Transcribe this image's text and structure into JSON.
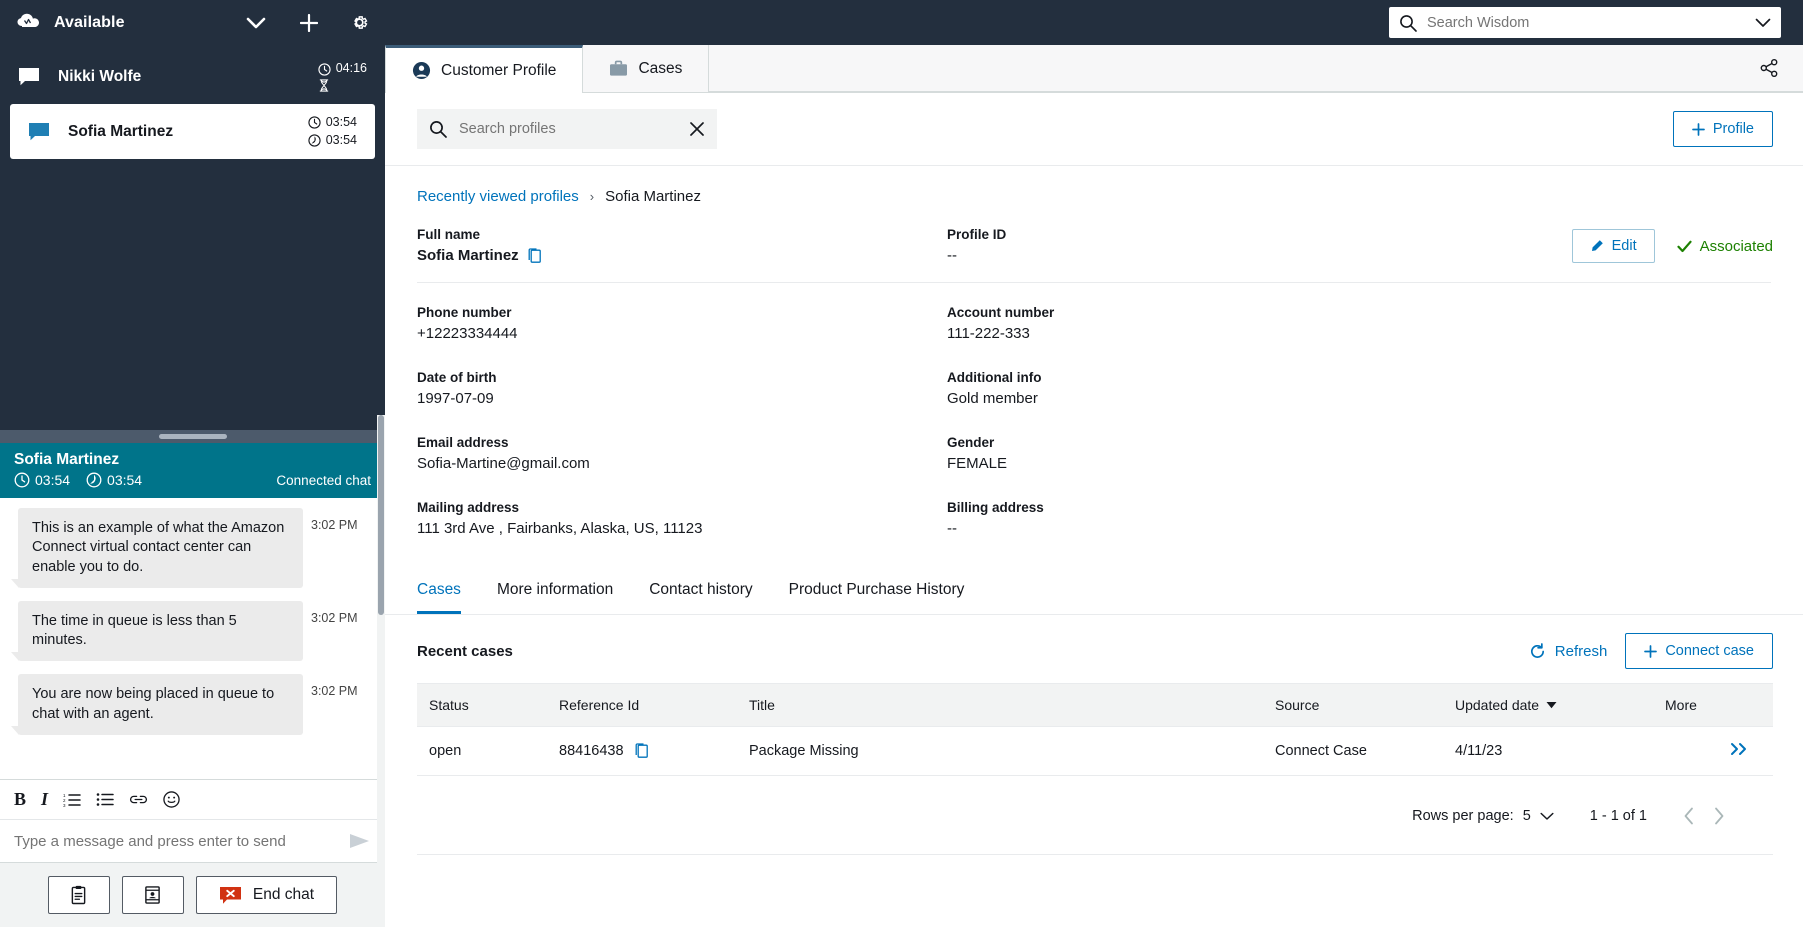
{
  "ccp": {
    "agent_status": "Available",
    "icons": {
      "logo": "amazon-connect-cloud-logo",
      "chevron": "chevron-down-icon",
      "plus": "plus-icon",
      "gear": "gear-icon"
    },
    "contacts": [
      {
        "name": "Nikki Wolfe",
        "timer_primary": "04:16",
        "timer_secondary": "",
        "active": false,
        "state_icon": "hourglass-icon"
      },
      {
        "name": "Sofia Martinez",
        "timer_primary": "03:54",
        "timer_secondary": "03:54",
        "active": true,
        "state_icon": "moon-icon"
      }
    ],
    "conversation": {
      "name": "Sofia Martinez",
      "timer_clock": "03:54",
      "timer_connected": "03:54",
      "state": "Connected chat"
    },
    "messages": [
      {
        "text": "This is an example of what the Amazon Connect virtual contact center can enable you to do.",
        "time": "3:02 PM"
      },
      {
        "text": "The time in queue is less than 5 minutes.",
        "time": "3:02 PM"
      },
      {
        "text": "You are now being placed in queue to chat with an agent.",
        "time": "3:02 PM"
      }
    ],
    "format_tools": [
      "bold-icon",
      "italic-icon",
      "numbered-list-icon",
      "bullet-list-icon",
      "link-icon",
      "emoji-icon"
    ],
    "format_labels": {
      "bold": "B",
      "italic": "I"
    },
    "composer_placeholder": "Type a message and press enter to send",
    "actions": {
      "quick_responses_icon": "clipboard-icon",
      "contact_attributes_icon": "contact-card-icon",
      "end_chat_label": "End chat",
      "end_chat_icon": "end-chat-icon"
    }
  },
  "topbar": {
    "search_placeholder": "Search Wisdom",
    "search_icon": "search-icon",
    "chevron_icon": "chevron-down-icon"
  },
  "tabs": [
    {
      "label": "Customer Profile",
      "icon": "user-circle-icon",
      "active": true
    },
    {
      "label": "Cases",
      "icon": "briefcase-icon",
      "active": false
    }
  ],
  "share_icon": "share-icon",
  "profile_search": {
    "placeholder": "Search profiles",
    "value": "",
    "search_icon": "search-icon",
    "clear_icon": "close-icon"
  },
  "add_profile_button": {
    "label": "Profile",
    "icon": "plus-icon"
  },
  "breadcrumb": {
    "root": "Recently viewed profiles",
    "separator": "›",
    "current": "Sofia Martinez"
  },
  "profile": {
    "edit_button": {
      "label": "Edit",
      "icon": "pencil-icon"
    },
    "association_status": {
      "label": "Associated",
      "icon": "check-icon",
      "color": "#1d8102"
    },
    "fields": [
      {
        "label": "Full name",
        "value": "Sofia Martinez",
        "bold": true,
        "copyable": true
      },
      {
        "label": "Profile ID",
        "value": "--",
        "bold": false,
        "copyable": false
      },
      {
        "label": "Phone number",
        "value": "+12223334444",
        "bold": false,
        "copyable": false
      },
      {
        "label": "Account number",
        "value": "111-222-333",
        "bold": false,
        "copyable": false
      },
      {
        "label": "Date of birth",
        "value": "1997-07-09",
        "bold": false,
        "copyable": false
      },
      {
        "label": "Additional info",
        "value": "Gold member",
        "bold": false,
        "copyable": false
      },
      {
        "label": "Email address",
        "value": "Sofia-Martine@gmail.com",
        "bold": false,
        "copyable": false
      },
      {
        "label": "Gender",
        "value": "FEMALE",
        "bold": false,
        "copyable": false
      },
      {
        "label": "Mailing address",
        "value": "111 3rd Ave , Fairbanks, Alaska, US, 11123",
        "bold": false,
        "copyable": false
      },
      {
        "label": "Billing address",
        "value": "--",
        "bold": false,
        "copyable": false
      }
    ]
  },
  "subtabs": [
    {
      "label": "Cases",
      "active": true
    },
    {
      "label": "More information",
      "active": false
    },
    {
      "label": "Contact history",
      "active": false
    },
    {
      "label": "Product Purchase History",
      "active": false
    }
  ],
  "cases_section": {
    "title": "Recent cases",
    "refresh_label": "Refresh",
    "refresh_icon": "refresh-icon",
    "connect_case_label": "Connect case",
    "connect_case_icon": "plus-icon",
    "columns": [
      "Status",
      "Reference Id",
      "Title",
      "Source",
      "Updated date",
      "More"
    ],
    "sorted_column": "Updated date",
    "sort_icon": "sort-desc-icon",
    "rows": [
      {
        "status": "open",
        "reference_id": "88416438",
        "reference_copy_icon": "copy-icon",
        "title": "Package Missing",
        "source": "Connect Case",
        "updated_date": "4/11/23",
        "more_icon": "double-chevron-right-icon"
      }
    ],
    "pagination": {
      "rows_per_page_label": "Rows per page:",
      "rows_per_page_value": "5",
      "range_label": "1 - 1 of 1",
      "prev_icon": "chevron-left-icon",
      "next_icon": "chevron-right-icon",
      "dropdown_icon": "chevron-down-icon"
    }
  },
  "colors": {
    "nav_dark": "#232f3e",
    "accent_teal": "#00748a",
    "link_blue": "#0073bb",
    "success_green": "#1d8102",
    "danger_red": "#d13212"
  }
}
